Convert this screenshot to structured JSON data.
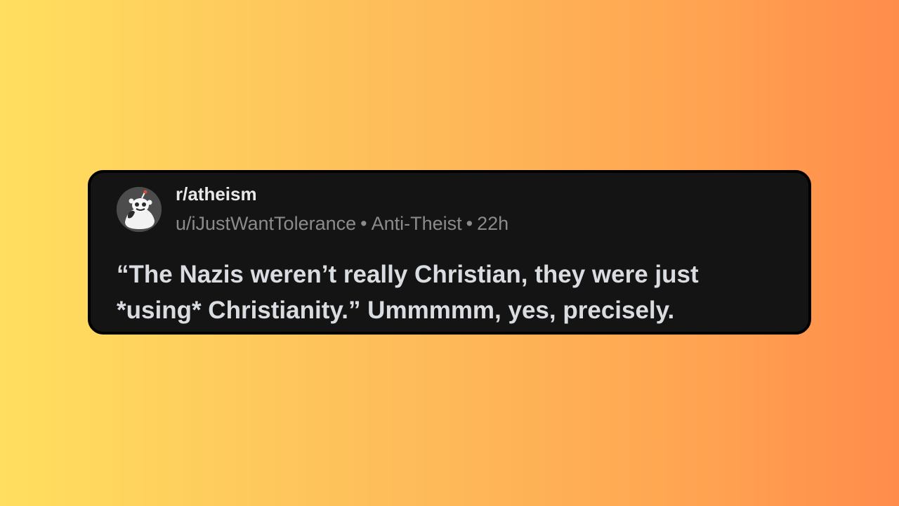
{
  "post": {
    "subreddit": "r/atheism",
    "avatar_icon": "snoo-avatar-icon",
    "author": "u/iJustWantTolerance",
    "flair": "Anti-Theist",
    "age": "22h",
    "separator": "•",
    "body_lines": [
      "“The Nazis weren’t really Christian, they were just",
      "*using* Christianity.” Ummmmm, yes, precisely."
    ]
  },
  "colors": {
    "card_background": "#141414",
    "card_border": "#000000",
    "text_primary": "#d9dce0",
    "text_meta": "#8b8b8b",
    "gradient_start": "#ffdf5f",
    "gradient_end": "#ff8c4b"
  }
}
